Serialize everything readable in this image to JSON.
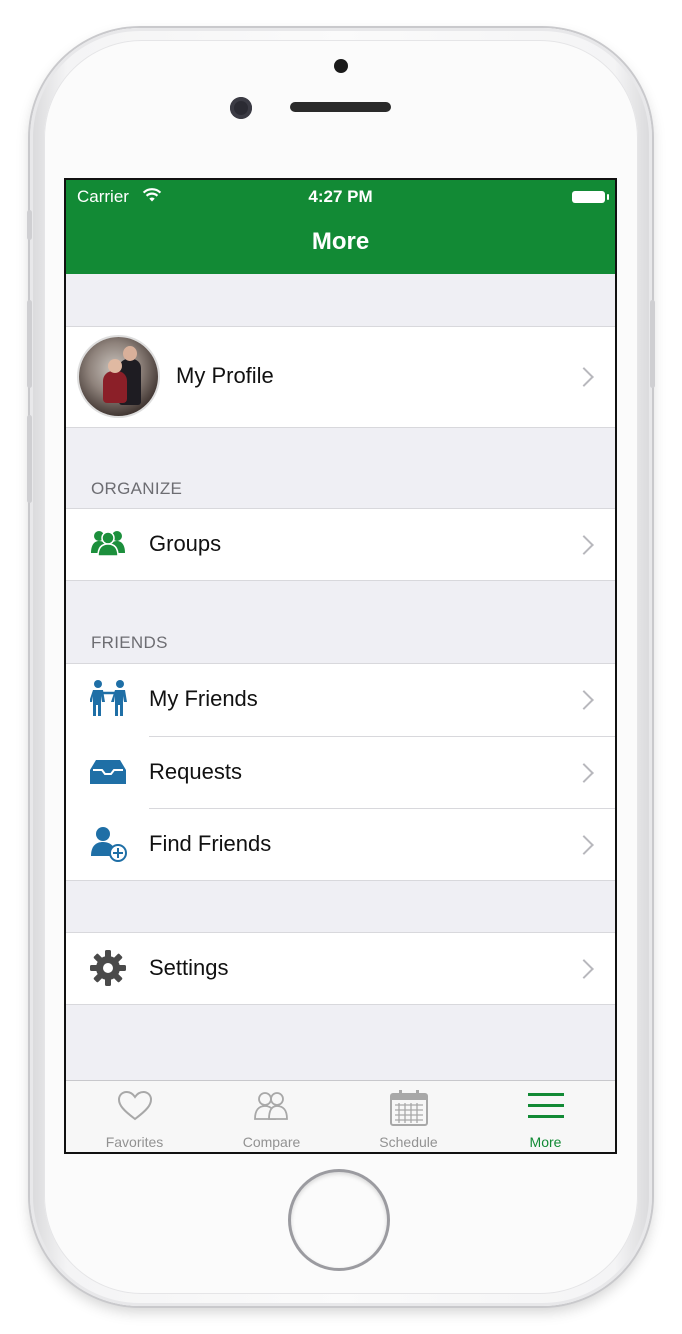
{
  "status_bar": {
    "carrier": "Carrier",
    "time": "4:27 PM"
  },
  "nav": {
    "title": "More"
  },
  "profile": {
    "label": "My Profile"
  },
  "sections": {
    "organize": {
      "header": "ORGANIZE",
      "items": [
        {
          "label": "Groups",
          "icon": "groups-icon"
        }
      ]
    },
    "friends": {
      "header": "FRIENDS",
      "items": [
        {
          "label": "My Friends",
          "icon": "friends-icon"
        },
        {
          "label": "Requests",
          "icon": "inbox-tray-icon"
        },
        {
          "label": "Find Friends",
          "icon": "add-user-icon"
        }
      ]
    },
    "settings": {
      "items": [
        {
          "label": "Settings",
          "icon": "gear-icon"
        }
      ]
    }
  },
  "tabbar": {
    "tabs": [
      {
        "label": "Favorites",
        "icon": "heart-icon",
        "active": false
      },
      {
        "label": "Compare",
        "icon": "compare-people-icon",
        "active": false
      },
      {
        "label": "Schedule",
        "icon": "calendar-icon",
        "active": false
      },
      {
        "label": "More",
        "icon": "menu-icon",
        "active": true
      }
    ]
  },
  "colors": {
    "brand_green": "#128a35",
    "icon_blue": "#1f6fa6",
    "group_green": "#1c8f3c",
    "gear_gray": "#4a4a4a",
    "background": "#efeff4"
  }
}
